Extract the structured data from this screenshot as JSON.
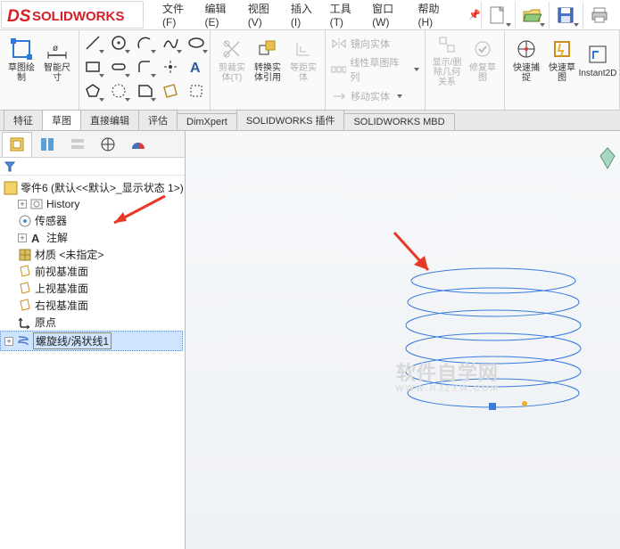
{
  "app": {
    "name": "SOLIDWORKS"
  },
  "menu": [
    "文件(F)",
    "编辑(E)",
    "视图(V)",
    "插入(I)",
    "工具(T)",
    "窗口(W)",
    "帮助(H)"
  ],
  "ribbon": {
    "sketch_btn": "草图绘\n制",
    "dim_btn": "智能尺\n寸",
    "trim_btn": "剪裁实\n体(T)",
    "convert_btn": "转换实\n体引用",
    "offset_btn": "等距实\n体",
    "mirror_btn": "镜向实体",
    "pattern_btn": "线性草图阵列",
    "move_btn": "移动实体",
    "relation_btn": "显示/删\n除几何\n关系",
    "repair_btn": "修复草\n图",
    "snap_btn": "快速捕\n捉",
    "rapid_btn": "快速草\n图",
    "instant_btn": "Instant2D"
  },
  "ftabs": [
    "特征",
    "草图",
    "直接编辑",
    "评估",
    "DimXpert",
    "SOLIDWORKS 插件",
    "SOLIDWORKS MBD"
  ],
  "ftab_active": 1,
  "tree": {
    "root": "零件6 (默认<<默认>_显示状态 1>)",
    "history": "History",
    "sensor": "传感器",
    "annotation": "注解",
    "material": "材质 <未指定>",
    "front": "前视基准面",
    "top": "上视基准面",
    "right": "右视基准面",
    "origin": "原点",
    "helix": "螺旋线/涡状线1"
  },
  "watermark": {
    "line1": "软件自学网",
    "line2": "WWW.RJZXW.COM"
  }
}
